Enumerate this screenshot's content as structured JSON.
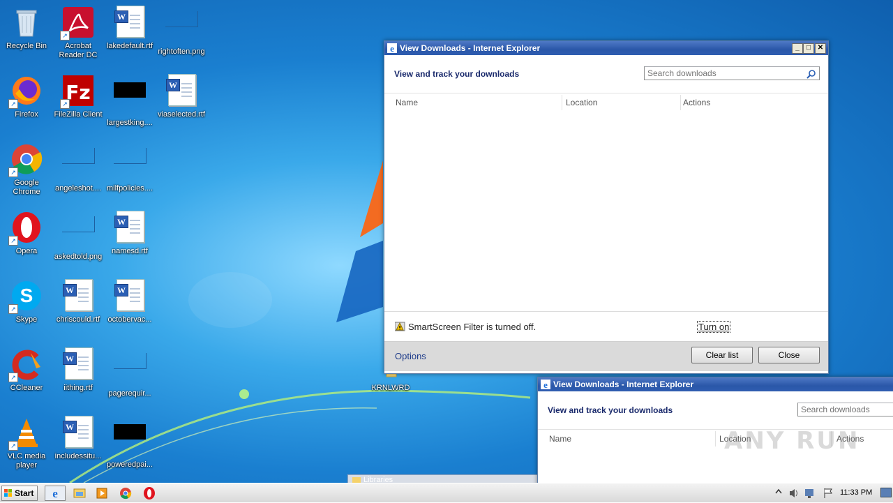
{
  "desktop": {
    "icons": [
      {
        "label": "Recycle Bin",
        "icon": "recycle-bin-icon"
      },
      {
        "label": "Acrobat Reader DC",
        "icon": "acrobat-icon"
      },
      {
        "label": "lakedefault.rtf",
        "icon": "word-document-icon"
      },
      {
        "label": "rightoften.png",
        "icon": "png-file-icon"
      },
      {
        "label": "Firefox",
        "icon": "firefox-icon"
      },
      {
        "label": "FileZilla Client",
        "icon": "filezilla-icon"
      },
      {
        "label": "largestking....",
        "icon": "black-file-icon"
      },
      {
        "label": "viaselected.rtf",
        "icon": "word-document-icon"
      },
      {
        "label": "Google Chrome",
        "icon": "chrome-icon"
      },
      {
        "label": "angeleshot....",
        "icon": "png-file-icon"
      },
      {
        "label": "milfpolicies....",
        "icon": "png-file-icon"
      },
      {
        "label": "Opera",
        "icon": "opera-icon"
      },
      {
        "label": "askedtold.png",
        "icon": "png-file-icon"
      },
      {
        "label": "namesd.rtf",
        "icon": "word-document-icon"
      },
      {
        "label": "Skype",
        "icon": "skype-icon"
      },
      {
        "label": "chriscould.rtf",
        "icon": "word-document-icon"
      },
      {
        "label": "octobervac...",
        "icon": "word-document-icon"
      },
      {
        "label": "CCleaner",
        "icon": "ccleaner-icon"
      },
      {
        "label": "iithing.rtf",
        "icon": "word-document-icon"
      },
      {
        "label": "pagerequir...",
        "icon": "png-file-icon"
      },
      {
        "label": "VLC media player",
        "icon": "vlc-icon"
      },
      {
        "label": "includessitu...",
        "icon": "word-document-icon"
      },
      {
        "label": "poweredpai...",
        "icon": "black-file-icon"
      },
      {
        "label": "KRNLWRD",
        "icon": "folder-icon"
      }
    ]
  },
  "window_main": {
    "title": "View Downloads - Internet Explorer",
    "heading": "View and track your downloads",
    "search_placeholder": "Search downloads",
    "columns": [
      "Name",
      "Location",
      "Actions"
    ],
    "smartscreen_text": "SmartScreen Filter is turned off.",
    "turn_on_label": "Turn on",
    "options_label": "Options",
    "clear_list_label": "Clear list",
    "close_label": "Close"
  },
  "window_second": {
    "title": "View Downloads - Internet Explorer",
    "heading": "View and track your downloads",
    "search_placeholder": "Search downloads",
    "columns": [
      "Name",
      "Location",
      "Actions"
    ]
  },
  "libraries_label": "Libraries",
  "taskbar": {
    "start_label": "Start",
    "pinned": [
      "internet-explorer-icon",
      "windows-explorer-icon",
      "media-player-icon",
      "chrome-icon",
      "opera-icon"
    ],
    "clock": "11:33 PM"
  },
  "watermark": "ANY RUN"
}
